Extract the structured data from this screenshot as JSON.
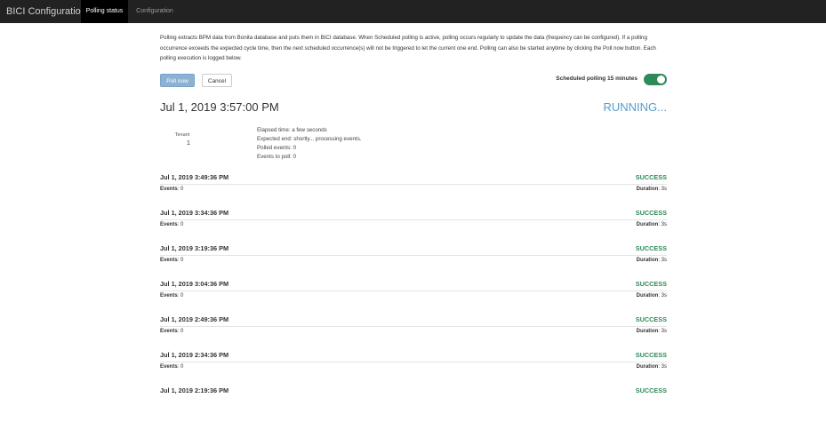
{
  "nav": {
    "brand": "BICI Configuration",
    "tabs": [
      "Polling status",
      "Configuration"
    ]
  },
  "description": "Polling extracts BPM data from Bonita database and puts them in BICI database. When Scheduled polling is active, polling occurs regularly to update the data (frequency can be configured). If a polling occurrence exceeds the expected cycle time, then the next scheduled occurrence(s) will not be triggered to let the current one end. Polling can also be started anytime by clicking the Poll now button. Each polling execution is logged below.",
  "buttons": {
    "poll_now": "Poll now",
    "cancel": "Cancel"
  },
  "scheduled": {
    "label": "Scheduled polling 15 minutes",
    "enabled": true,
    "toggle_color": "#2e8b57"
  },
  "current": {
    "time": "Jul 1, 2019 3:57:00 PM",
    "status": "RUNNING...",
    "status_color": "#5a9bc9",
    "tenant_label": "Tenant",
    "tenant_value": "1",
    "stats": [
      "Elapsed time: a few seconds",
      "Expected end: shortly... processing events.",
      "Polled events: 0",
      "Events to poll: 0"
    ]
  },
  "history_labels": {
    "events": "Events",
    "duration": "Duration"
  },
  "history": [
    {
      "time": "Jul 1, 2019 3:49:36 PM",
      "status": "SUCCESS",
      "events": "0",
      "duration": "3s"
    },
    {
      "time": "Jul 1, 2019 3:34:36 PM",
      "status": "SUCCESS",
      "events": "0",
      "duration": "3s"
    },
    {
      "time": "Jul 1, 2019 3:19:36 PM",
      "status": "SUCCESS",
      "events": "0",
      "duration": "3s"
    },
    {
      "time": "Jul 1, 2019 3:04:36 PM",
      "status": "SUCCESS",
      "events": "0",
      "duration": "3s"
    },
    {
      "time": "Jul 1, 2019 2:49:36 PM",
      "status": "SUCCESS",
      "events": "0",
      "duration": "3s"
    },
    {
      "time": "Jul 1, 2019 2:34:36 PM",
      "status": "SUCCESS",
      "events": "0",
      "duration": "3s"
    },
    {
      "time": "Jul 1, 2019 2:19:36 PM",
      "status": "SUCCESS",
      "events": "",
      "duration": ""
    }
  ]
}
